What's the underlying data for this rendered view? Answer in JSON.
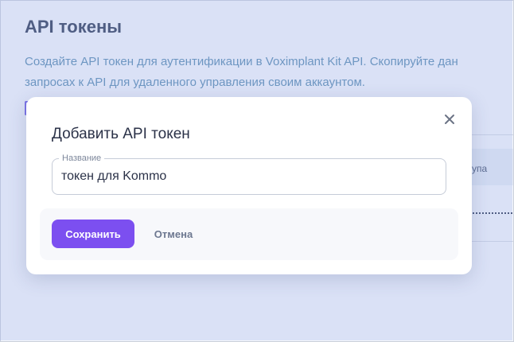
{
  "page": {
    "title": "API токены",
    "description_line1": "Создайте API токен для аутентификации в Voximplant Kit API. Скопируйте дан",
    "description_line2": "запросах к API для удаленного управления своим аккаунтом.",
    "table_header_fragment": "упа"
  },
  "modal": {
    "title": "Добавить API токен",
    "close_icon": "close-icon",
    "name_field": {
      "label": "Название",
      "value": "токен для Kommo"
    },
    "save_label": "Сохранить",
    "cancel_label": "Отмена"
  },
  "colors": {
    "accent": "#7c4ff0",
    "overlay": "#9bafeb",
    "title_text": "#2f3a56",
    "description_text": "#5a8bb0"
  }
}
